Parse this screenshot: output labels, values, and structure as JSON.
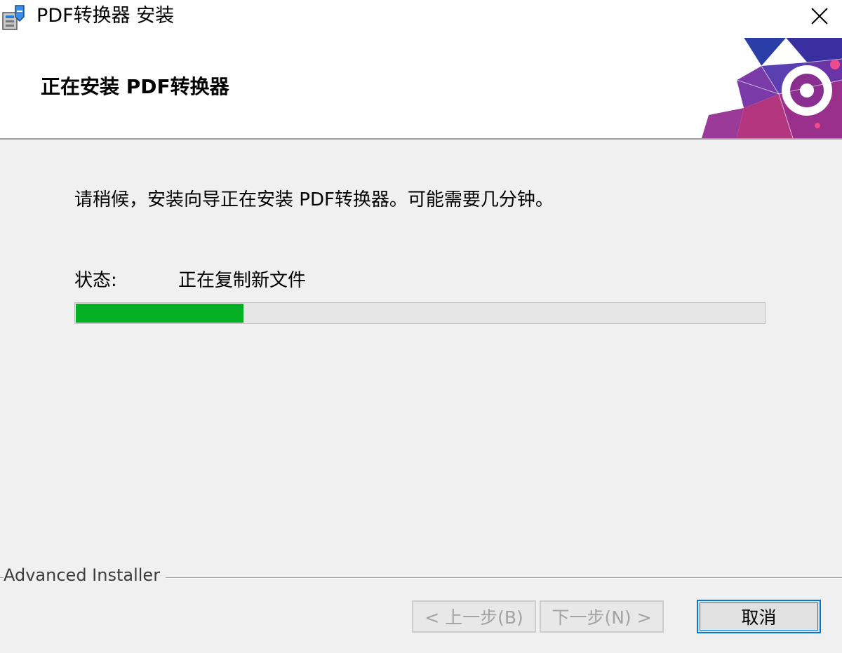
{
  "window": {
    "title": "PDF转换器 安装"
  },
  "header": {
    "title": "正在安装 PDF转换器"
  },
  "body": {
    "description": "请稍候，安装向导正在安装 PDF转换器。可能需要几分钟。",
    "status_label": "状态:",
    "status_value": "正在复制新文件",
    "progress_fraction": 0.245
  },
  "footer": {
    "brand": "Advanced Installer",
    "back_label": "< 上一步(B)",
    "next_label": "下一步(N) >",
    "cancel_label": "取消"
  },
  "colors": {
    "progress_fill": "#06b025",
    "focus_border": "#0078d7"
  },
  "icons": [
    "installer-app-icon",
    "close-icon"
  ]
}
